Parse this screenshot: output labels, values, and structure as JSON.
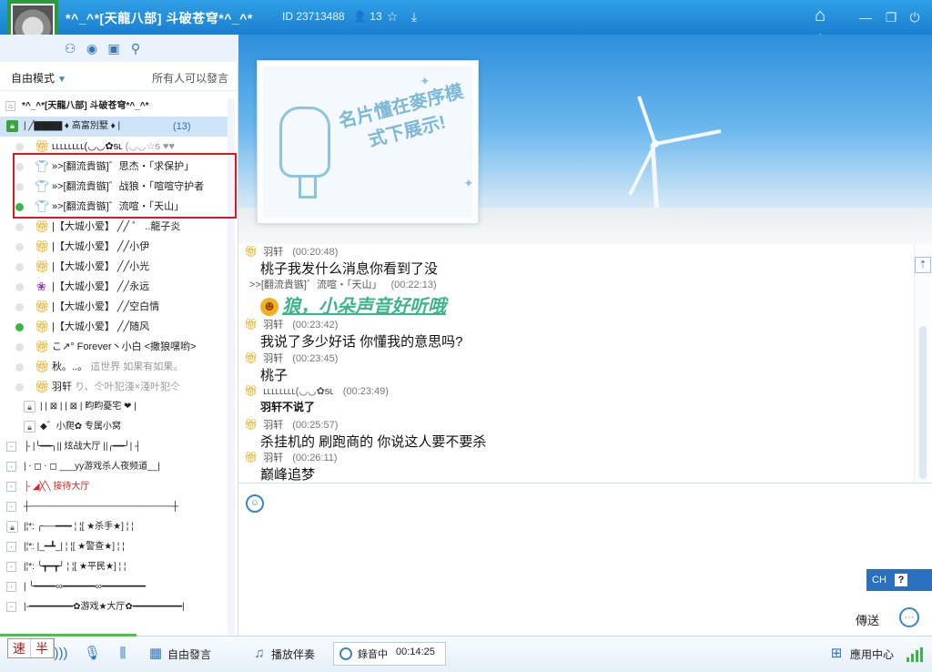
{
  "titlebar": {
    "room_title": "*^_^*[天龍八部] 斗破苍穹*^_^*",
    "room_id": "ID 23713488",
    "online_count": "13"
  },
  "sidebar": {
    "mode_label": "自由模式",
    "permission_text": "所有人可以發言",
    "room_root": "*^_^*[天龍八部] 斗破苍穹*^_^*",
    "active_channel": {
      "name": "|  ╱▇▇▇▇  ♦ 高富別墅 ♦  |",
      "count": "(13)"
    },
    "users": [
      {
        "name": "ʟʟʟʟʟʟʟʟ(◡◡✿ᵴʟ",
        "extra": "(◡◡☆ᵴ  ♥♥",
        "icon": "rank-yellow"
      },
      {
        "name": "»>[翻流貴镞]゛思杰・「求保护」",
        "icon": "shirt"
      },
      {
        "name": "»>[翻流貴镞]゛战狼・「喧喧守护者",
        "icon": "shirt"
      },
      {
        "name": "»>[翻流貴镞]゛流喧・「天山」",
        "icon": "shirt",
        "online": true
      },
      {
        "name": "|【大城小爱】  ╱╱ ゜ ..龍子炎",
        "icon": "rank-orange"
      },
      {
        "name": "|【大城小爱】  ╱╱小伊",
        "icon": "rank-orange"
      },
      {
        "name": "|【大城小爱】  ╱╱小光",
        "icon": "rank-orange"
      },
      {
        "name": "|【大城小爱】  ╱╱永远",
        "icon": "rank-purple"
      },
      {
        "name": "|【大城小爱】  ╱╱空白情",
        "icon": "rank-orange"
      },
      {
        "name": "|【大城小爱】  ╱╱随风",
        "icon": "rank-orange",
        "online": true
      },
      {
        "name": "こ↗° Forever丶小白 <撒狼嘿哟>",
        "icon": "rank-orange"
      },
      {
        "name": "秋。..。",
        "extra": "這世界  如果有如果。",
        "icon": "rank-yellow"
      },
      {
        "name": "羽轩",
        "extra": "り、仒叶犯淺×淺叶犯仒",
        "icon": "rank-orange"
      }
    ],
    "sub_channels": [
      "|  | ⊠ |  | ⊠ |   畇畇憂宅  ❤  |",
      "◆゛小爬✿  专属小窝"
    ],
    "channels": [
      {
        "name": "├ |╰━━╮|| 炫战大厅 ||╭━━╯| ┤",
        "lock": false
      },
      {
        "name": "|    ⋅ ◻    ⋅ ◻    ___yy游戏杀人夜频道__|",
        "lock": false
      },
      {
        "name": "├   ◢╳╲  接待大厅",
        "lock": false,
        "red": true
      },
      {
        "name": "┼──────────────────────┼",
        "lock": false
      },
      {
        "name": "|¦*:  ╭──━━━  ¦ ¦[ ★杀手★] ¦ ¦",
        "lock": true
      },
      {
        "name": "|¦*:  |_━┻_|  ¦ ¦[ ★警查★] ¦ ¦",
        "lock": false
      },
      {
        "name": "|¦*:  ╰┳━┳╯  ¦ ¦[ ★平民★] ¦ ¦",
        "lock": false
      },
      {
        "name": "|  ╰━━━━∞━━━━━━∞━━━━━━━━",
        "lock": false
      },
      {
        "name": "|-━━━━━━━━✿游戏★大厅✿━━━━━━━━━|",
        "lock": false
      }
    ]
  },
  "banner": {
    "card_text": "名片懂在麥序模式下展示!"
  },
  "chat": {
    "messages": [
      {
        "user": "羽轩",
        "time": "(00:20:48)",
        "text": "桃子我发什么消息你看到了没"
      },
      {
        "user": ">>[翻流貴镞]゛流喧・「天山」",
        "time": "(00:22:13)",
        "text": "狼，小朵声音好听哦"
      },
      {
        "user": "羽轩",
        "time": "(00:23:42)",
        "text": "我说了多少好话    你懂我的意思吗?"
      },
      {
        "user": "羽轩",
        "time": "(00:23:45)",
        "text": "桃子"
      },
      {
        "user": "ʟʟʟʟʟʟʟʟ(◡◡✿ᵴʟ",
        "time": "(00:23:49)",
        "text": "羽轩不说了"
      },
      {
        "user": "羽轩",
        "time": "(00:25:57)",
        "text": "杀挂机的      刷跑商的     你说这人要不要杀"
      },
      {
        "user": "羽轩",
        "time": "(00:26:11)",
        "text": "巅峰追梦"
      }
    ]
  },
  "input": {
    "ime_label": "CH",
    "ime_help": "?",
    "send_label": "傳送"
  },
  "bottombar": {
    "speed_1": "速",
    "speed_2": "半",
    "free_speech": "自由發言",
    "play_music": "播放伴奏",
    "recording_label": "錄音中",
    "recording_time": "00:14:25",
    "app_center": "應用中心"
  },
  "colors": {
    "titlebar": "#1a7fcf",
    "accent": "#3a85c8",
    "online": "#39b54a",
    "highlight": "#e3161c"
  }
}
